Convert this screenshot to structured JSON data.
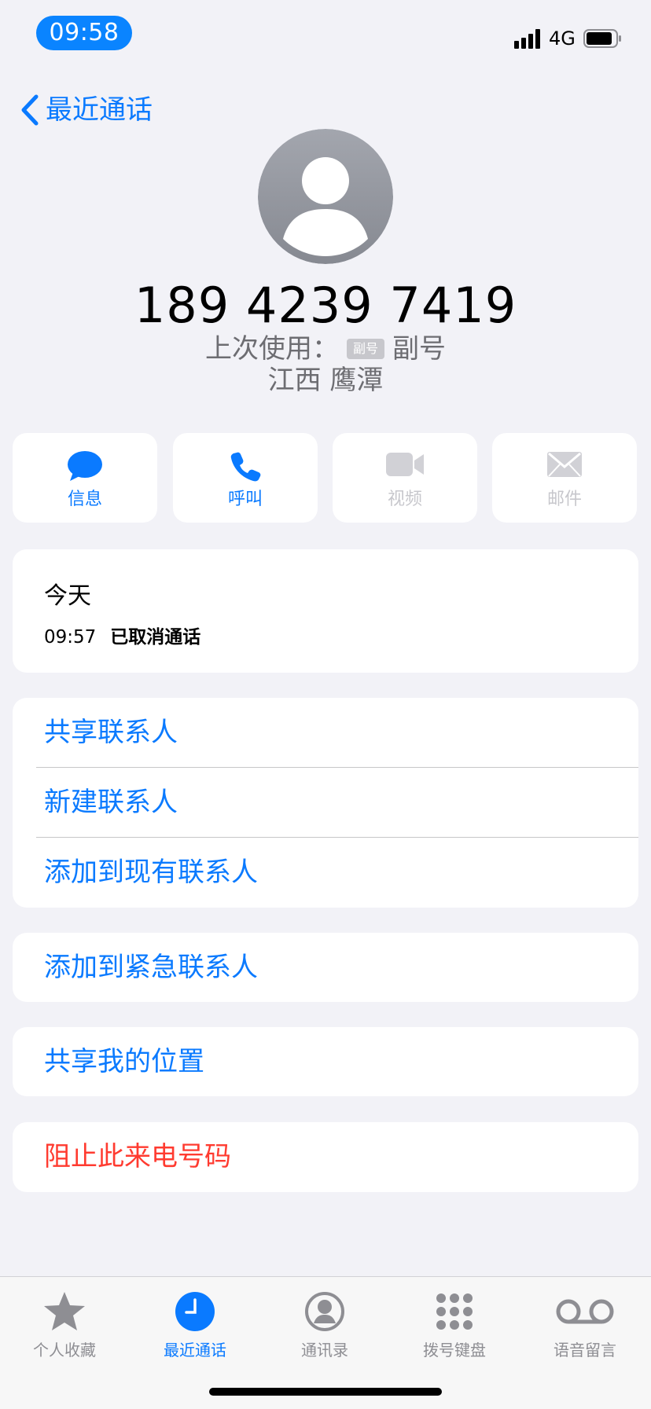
{
  "status_bar": {
    "time": "09:58",
    "network": "4G"
  },
  "nav": {
    "back_label": "最近通话"
  },
  "contact": {
    "phone_number": "189 4239 7419",
    "last_used_prefix": "上次使用：",
    "last_used_badge": "副号",
    "last_used_line": "副号",
    "location": "江西 鹰潭"
  },
  "actions": [
    {
      "label": "信息",
      "icon": "message-icon",
      "enabled": true
    },
    {
      "label": "呼叫",
      "icon": "phone-icon",
      "enabled": true
    },
    {
      "label": "视频",
      "icon": "video-icon",
      "enabled": false
    },
    {
      "label": "邮件",
      "icon": "mail-icon",
      "enabled": false
    }
  ],
  "recent": {
    "day": "今天",
    "calls": [
      {
        "time": "09:57",
        "status": "已取消通话"
      }
    ]
  },
  "contact_options": [
    "共享联系人",
    "新建联系人",
    "添加到现有联系人"
  ],
  "emergency": "添加到紧急联系人",
  "share_location": "共享我的位置",
  "block": "阻止此来电号码",
  "tabs": [
    {
      "label": "个人收藏",
      "icon": "star-icon",
      "active": false
    },
    {
      "label": "最近通话",
      "icon": "clock-icon",
      "active": true
    },
    {
      "label": "通讯录",
      "icon": "contacts-icon",
      "active": false
    },
    {
      "label": "拨号键盘",
      "icon": "keypad-icon",
      "active": false
    },
    {
      "label": "语音留言",
      "icon": "voicemail-icon",
      "active": false
    }
  ],
  "colors": {
    "accent": "#0a7aff",
    "destructive": "#ff3b30",
    "background": "#f2f2f7"
  }
}
